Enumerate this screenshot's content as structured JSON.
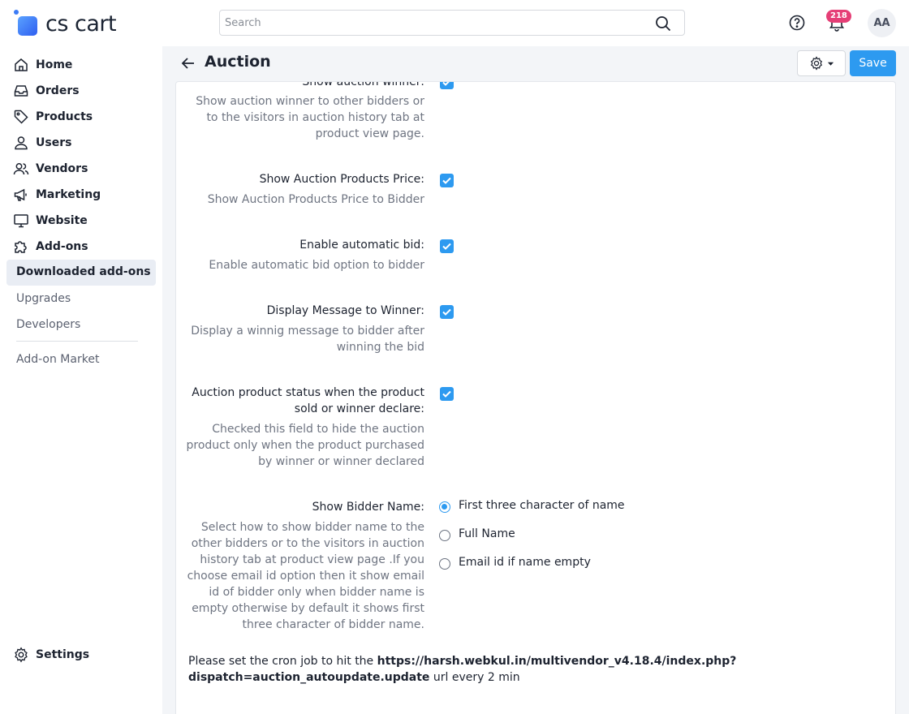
{
  "brand": {
    "name": "cs cart"
  },
  "search": {
    "placeholder": "Search"
  },
  "header": {
    "notifications_count": "218",
    "avatar_initials": "AA"
  },
  "sidebar": {
    "items": [
      {
        "label": "Home",
        "icon": "home-icon"
      },
      {
        "label": "Orders",
        "icon": "inbox-icon"
      },
      {
        "label": "Products",
        "icon": "tag-icon"
      },
      {
        "label": "Users",
        "icon": "user-icon"
      },
      {
        "label": "Vendors",
        "icon": "users-icon"
      },
      {
        "label": "Marketing",
        "icon": "megaphone-icon"
      },
      {
        "label": "Website",
        "icon": "monitor-icon"
      },
      {
        "label": "Add-ons",
        "icon": "puzzle-icon"
      }
    ],
    "subitems": [
      "Downloaded add-ons",
      "Upgrades",
      "Developers"
    ],
    "market": "Add-on Market",
    "settings": "Settings"
  },
  "page": {
    "title": "Auction",
    "save_label": "Save"
  },
  "settings": {
    "show_winner": {
      "label": "Show auction winner:",
      "desc": "Show auction winner to other bidders or to the visitors in auction history tab at product view page.",
      "checked": true
    },
    "show_price": {
      "label": "Show Auction Products Price:",
      "desc": "Show Auction Products Price to Bidder",
      "checked": true
    },
    "auto_bid": {
      "label": "Enable automatic bid:",
      "desc": "Enable automatic bid option to bidder",
      "checked": true
    },
    "winner_msg": {
      "label": "Display Message to Winner:",
      "desc": "Display a winnig message to bidder after winning the bid",
      "checked": true
    },
    "product_status": {
      "label": "Auction product status when the product sold or winner declare:",
      "desc": "Checked this field to hide the auction product only when the product purchased by winner or winner declared",
      "checked": true
    },
    "bidder_name": {
      "label": "Show Bidder Name:",
      "desc": "Select how to show bidder name to the other bidders or to the visitors in auction history tab at product view page .If you choose email id option then it show email id of bidder only when bidder name is empty otherwise by default it shows first three character of bidder name.",
      "options": [
        "First three character of name",
        "Full Name",
        "Email id if name empty"
      ],
      "selected": "First three character of name"
    }
  },
  "cron": {
    "prefix": "Please set the cron job to hit the ",
    "url": "https://harsh.webkul.in/multivendor_v4.18.4/index.php?dispatch=auction_autoupdate.update",
    "suffix": " url every 2 min"
  },
  "colors": {
    "accent": "#2d9af0",
    "badge": "#e53f76"
  }
}
